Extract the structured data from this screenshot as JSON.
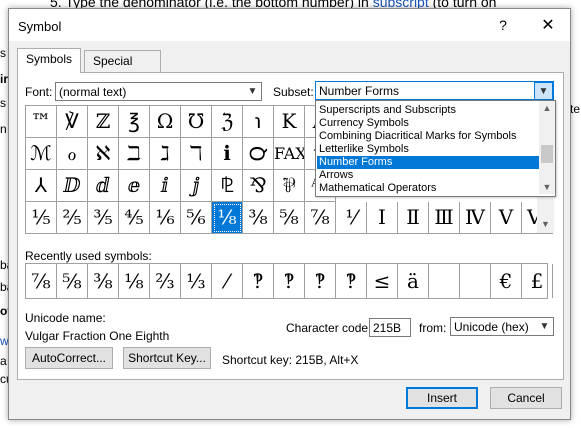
{
  "background": {
    "doc_line_prefix": "5.   Type the denominator (i.e. the bottom number) in ",
    "doc_line_link": "subscript",
    "doc_line_suffix": " (to turn on",
    "fragments": [
      "s",
      "ir",
      "s",
      "n",
      "ba",
      "ba",
      "ot",
      "w",
      "a",
      "cu",
      "te"
    ]
  },
  "dialog": {
    "title": "Symbol",
    "help": "?",
    "close": "✕",
    "tabs": [
      "Symbols",
      "Special Characters"
    ],
    "font_label": "Font:",
    "font_value": "(normal text)",
    "subset_label": "Subset:",
    "subset_value": "Number Forms",
    "subset_options": [
      "Superscripts and Subscripts",
      "Currency Symbols",
      "Combining Diacritical Marks for Symbols",
      "Letterlike Symbols",
      "Number Forms",
      "Arrows",
      "Mathematical Operators"
    ],
    "subset_selected_index": 4,
    "symbols": [
      [
        "™",
        "℣",
        "ℤ",
        "℥",
        "Ω",
        "℧",
        "ℨ",
        "℩",
        "K",
        "Å"
      ],
      [
        "ℳ",
        "ℴ",
        "ℵ",
        "ℶ",
        "ℷ",
        "ℸ",
        "ℹ",
        "℺",
        "FAX",
        "ℽ"
      ],
      [
        "⅄",
        "ⅅ",
        "ⅆ",
        "ⅇ",
        "ⅈ",
        "ⅉ",
        "⅊",
        "⅋",
        "⅌",
        "⅍"
      ],
      [
        "⅓",
        "⅔",
        "⅕",
        "⅖",
        "⅗",
        "⅘",
        "⅙",
        "⅚",
        "⅛",
        "⅜",
        "⅝",
        "⅞",
        "⅟",
        "Ⅰ",
        "Ⅱ",
        "Ⅲ",
        "Ⅳ",
        "Ⅴ",
        "Ⅵ"
      ]
    ],
    "symbols_row4_display": [
      "¹⁄₅",
      "²⁄₅",
      "³⁄₅",
      "⁴⁄₅",
      "¹⁄₆",
      "⁵⁄₆",
      "¹⁄₈",
      "³⁄₈",
      "⁵⁄₈",
      "⁷⁄₈",
      "¹⁄",
      "Ⅰ",
      "Ⅱ",
      "Ⅲ",
      "Ⅳ",
      "Ⅴ",
      "Ⅵ"
    ],
    "selected_symbol_index": 6,
    "recent_label": "Recently used symbols:",
    "recent_symbols": [
      "⅞",
      "⅝",
      "⅜",
      "⅛",
      "⅔",
      "⅓",
      "⁄",
      "‽",
      "‽",
      "‽",
      "‽",
      "≤",
      "ä",
      "",
      "",
      "€",
      "£"
    ],
    "unicode_name_label": "Unicode name:",
    "unicode_name_value": "Vulgar Fraction One Eighth",
    "char_code_label": "Character code:",
    "char_code_value": "215B",
    "from_label": "from:",
    "from_value": "Unicode (hex)",
    "autocorrect_label": "AutoCorrect...",
    "shortcut_key_btn_label": "Shortcut Key...",
    "shortcut_key_text": "Shortcut key: 215B, Alt+X",
    "insert_label": "Insert",
    "cancel_label": "Cancel"
  }
}
